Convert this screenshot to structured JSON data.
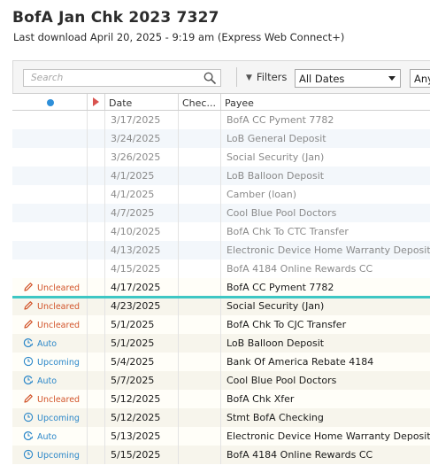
{
  "header": {
    "title": "BofA Jan Chk 2023 7327",
    "subtitle": "Last download April 20, 2025 - 9:19 am (Express Web Connect+)"
  },
  "toolbar": {
    "search_placeholder": "Search",
    "filters_label": "Filters",
    "date_filter_value": "All Dates",
    "type_filter_value": "Any"
  },
  "columns": {
    "status": "",
    "flag": "",
    "date": "Date",
    "check": "Chec...",
    "payee": "Payee"
  },
  "colors": {
    "uncleared": "#d2542a",
    "scheduled": "#2b87c9",
    "today_line": "#3ec7c4",
    "flag": "#d9534f"
  },
  "posted_rows": [
    {
      "date": "3/17/2025",
      "check": "",
      "payee": "BofA CC Pyment 7782"
    },
    {
      "date": "3/24/2025",
      "check": "",
      "payee": "LoB General Deposit"
    },
    {
      "date": "3/26/2025",
      "check": "",
      "payee": "Social Security (Jan)"
    },
    {
      "date": "4/1/2025",
      "check": "",
      "payee": "LoB Balloon Deposit"
    },
    {
      "date": "4/1/2025",
      "check": "",
      "payee": "Camber (loan)"
    },
    {
      "date": "4/7/2025",
      "check": "",
      "payee": "Cool Blue Pool Doctors"
    },
    {
      "date": "4/10/2025",
      "check": "",
      "payee": "BofA Chk To CTC Transfer"
    },
    {
      "date": "4/13/2025",
      "check": "",
      "payee": "Electronic Device Home Warranty Deposit"
    },
    {
      "date": "4/15/2025",
      "check": "",
      "payee": "BofA 4184 Online Rewards CC"
    }
  ],
  "pending_rows": [
    {
      "status": "Uncleared",
      "status_icon": "pencil-icon",
      "date": "4/17/2025",
      "check": "",
      "payee": "BofA CC Pyment 7782"
    },
    {
      "status": "Uncleared",
      "status_icon": "pencil-icon",
      "date": "4/23/2025",
      "check": "",
      "payee": "Social Security (Jan)"
    },
    {
      "status": "Uncleared",
      "status_icon": "pencil-icon",
      "date": "5/1/2025",
      "check": "",
      "payee": "BofA Chk To CJC Transfer"
    },
    {
      "status": "Auto",
      "status_icon": "auto-clock-icon",
      "date": "5/1/2025",
      "check": "",
      "payee": "LoB Balloon Deposit"
    },
    {
      "status": "Upcoming",
      "status_icon": "clock-icon",
      "date": "5/4/2025",
      "check": "",
      "payee": "Bank Of America Rebate 4184"
    },
    {
      "status": "Auto",
      "status_icon": "auto-clock-icon",
      "date": "5/7/2025",
      "check": "",
      "payee": "Cool Blue Pool Doctors"
    },
    {
      "status": "Uncleared",
      "status_icon": "pencil-icon",
      "date": "5/12/2025",
      "check": "",
      "payee": "BofA Chk Xfer"
    },
    {
      "status": "Upcoming",
      "status_icon": "clock-icon",
      "date": "5/12/2025",
      "check": "",
      "payee": "Stmt BofA Checking"
    },
    {
      "status": "Auto",
      "status_icon": "auto-clock-icon",
      "date": "5/13/2025",
      "check": "",
      "payee": "Electronic Device Home Warranty Deposit"
    },
    {
      "status": "Upcoming",
      "status_icon": "clock-icon",
      "date": "5/15/2025",
      "check": "",
      "payee": "BofA 4184 Online Rewards CC"
    }
  ]
}
